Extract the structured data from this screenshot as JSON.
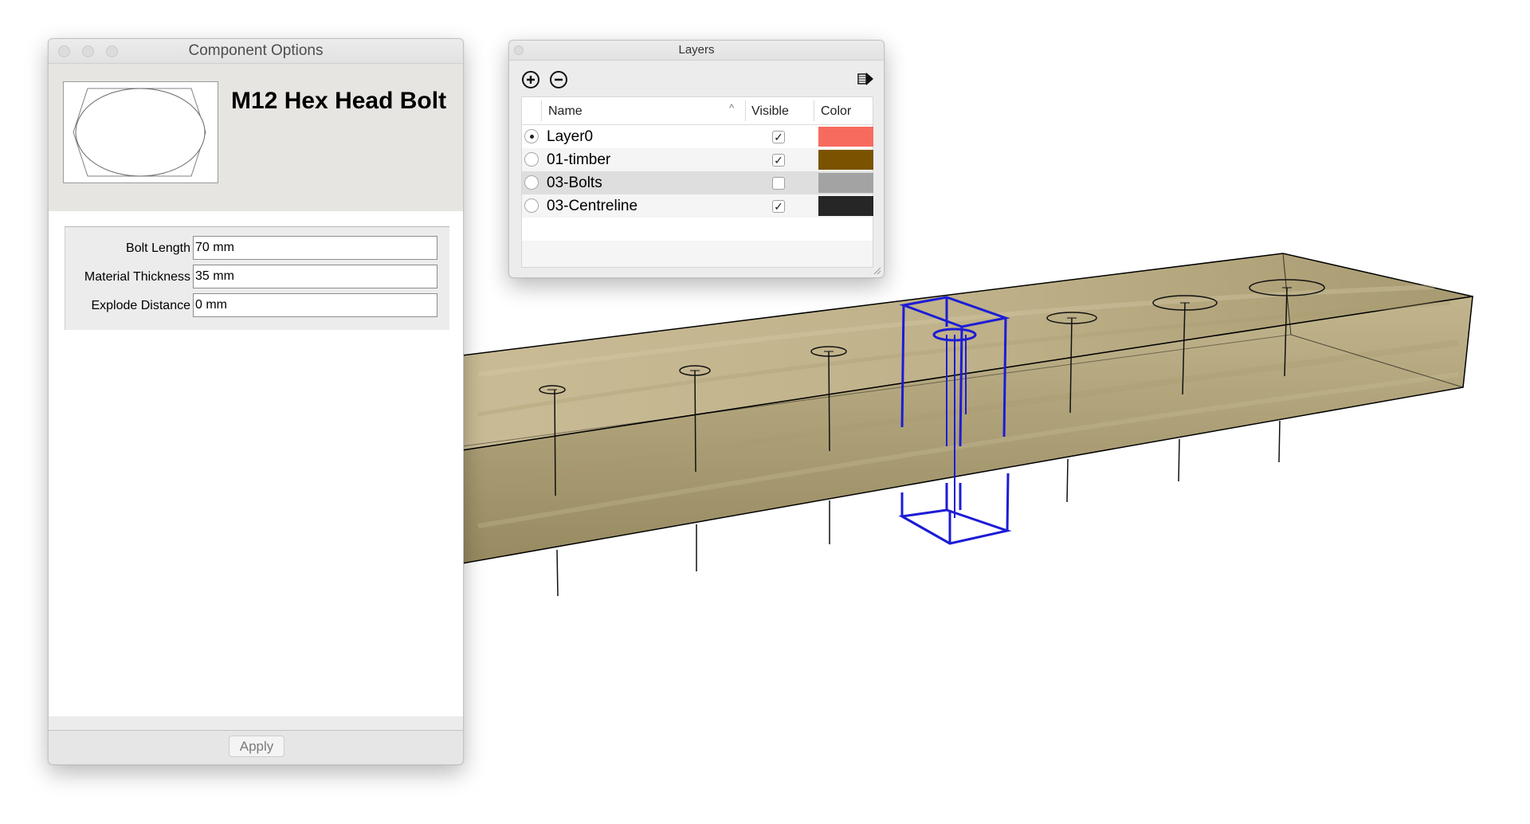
{
  "component_options": {
    "window_title": "Component Options",
    "component_title": "M12 Hex Head Bolt",
    "fields": [
      {
        "label": "Bolt Length",
        "value": "70 mm"
      },
      {
        "label": "Material Thickness",
        "value": "35 mm"
      },
      {
        "label": "Explode Distance",
        "value": "0 mm"
      }
    ],
    "apply_label": "Apply"
  },
  "layers": {
    "window_title": "Layers",
    "toolbar": {
      "add_icon": "plus-circle-icon",
      "remove_icon": "minus-circle-icon",
      "details_icon": "details-arrow-icon"
    },
    "columns": {
      "name": "Name",
      "visible": "Visible",
      "color": "Color"
    },
    "sort_indicator": "^",
    "rows": [
      {
        "name": "Layer0",
        "active": true,
        "visible": true,
        "color": "#f76b5f",
        "check": "✓"
      },
      {
        "name": "01-timber",
        "active": false,
        "visible": true,
        "color": "#7b5300",
        "check": "✓"
      },
      {
        "name": "03-Bolts",
        "active": false,
        "visible": false,
        "color": "#a3a3a3",
        "check": ""
      },
      {
        "name": "03-Centreline",
        "active": false,
        "visible": true,
        "color": "#262626",
        "check": "✓"
      }
    ]
  },
  "scene": {
    "timber_color": "#b3a57c",
    "bolt_count": 8,
    "selected_bolt_color": "#1c1cd6"
  }
}
